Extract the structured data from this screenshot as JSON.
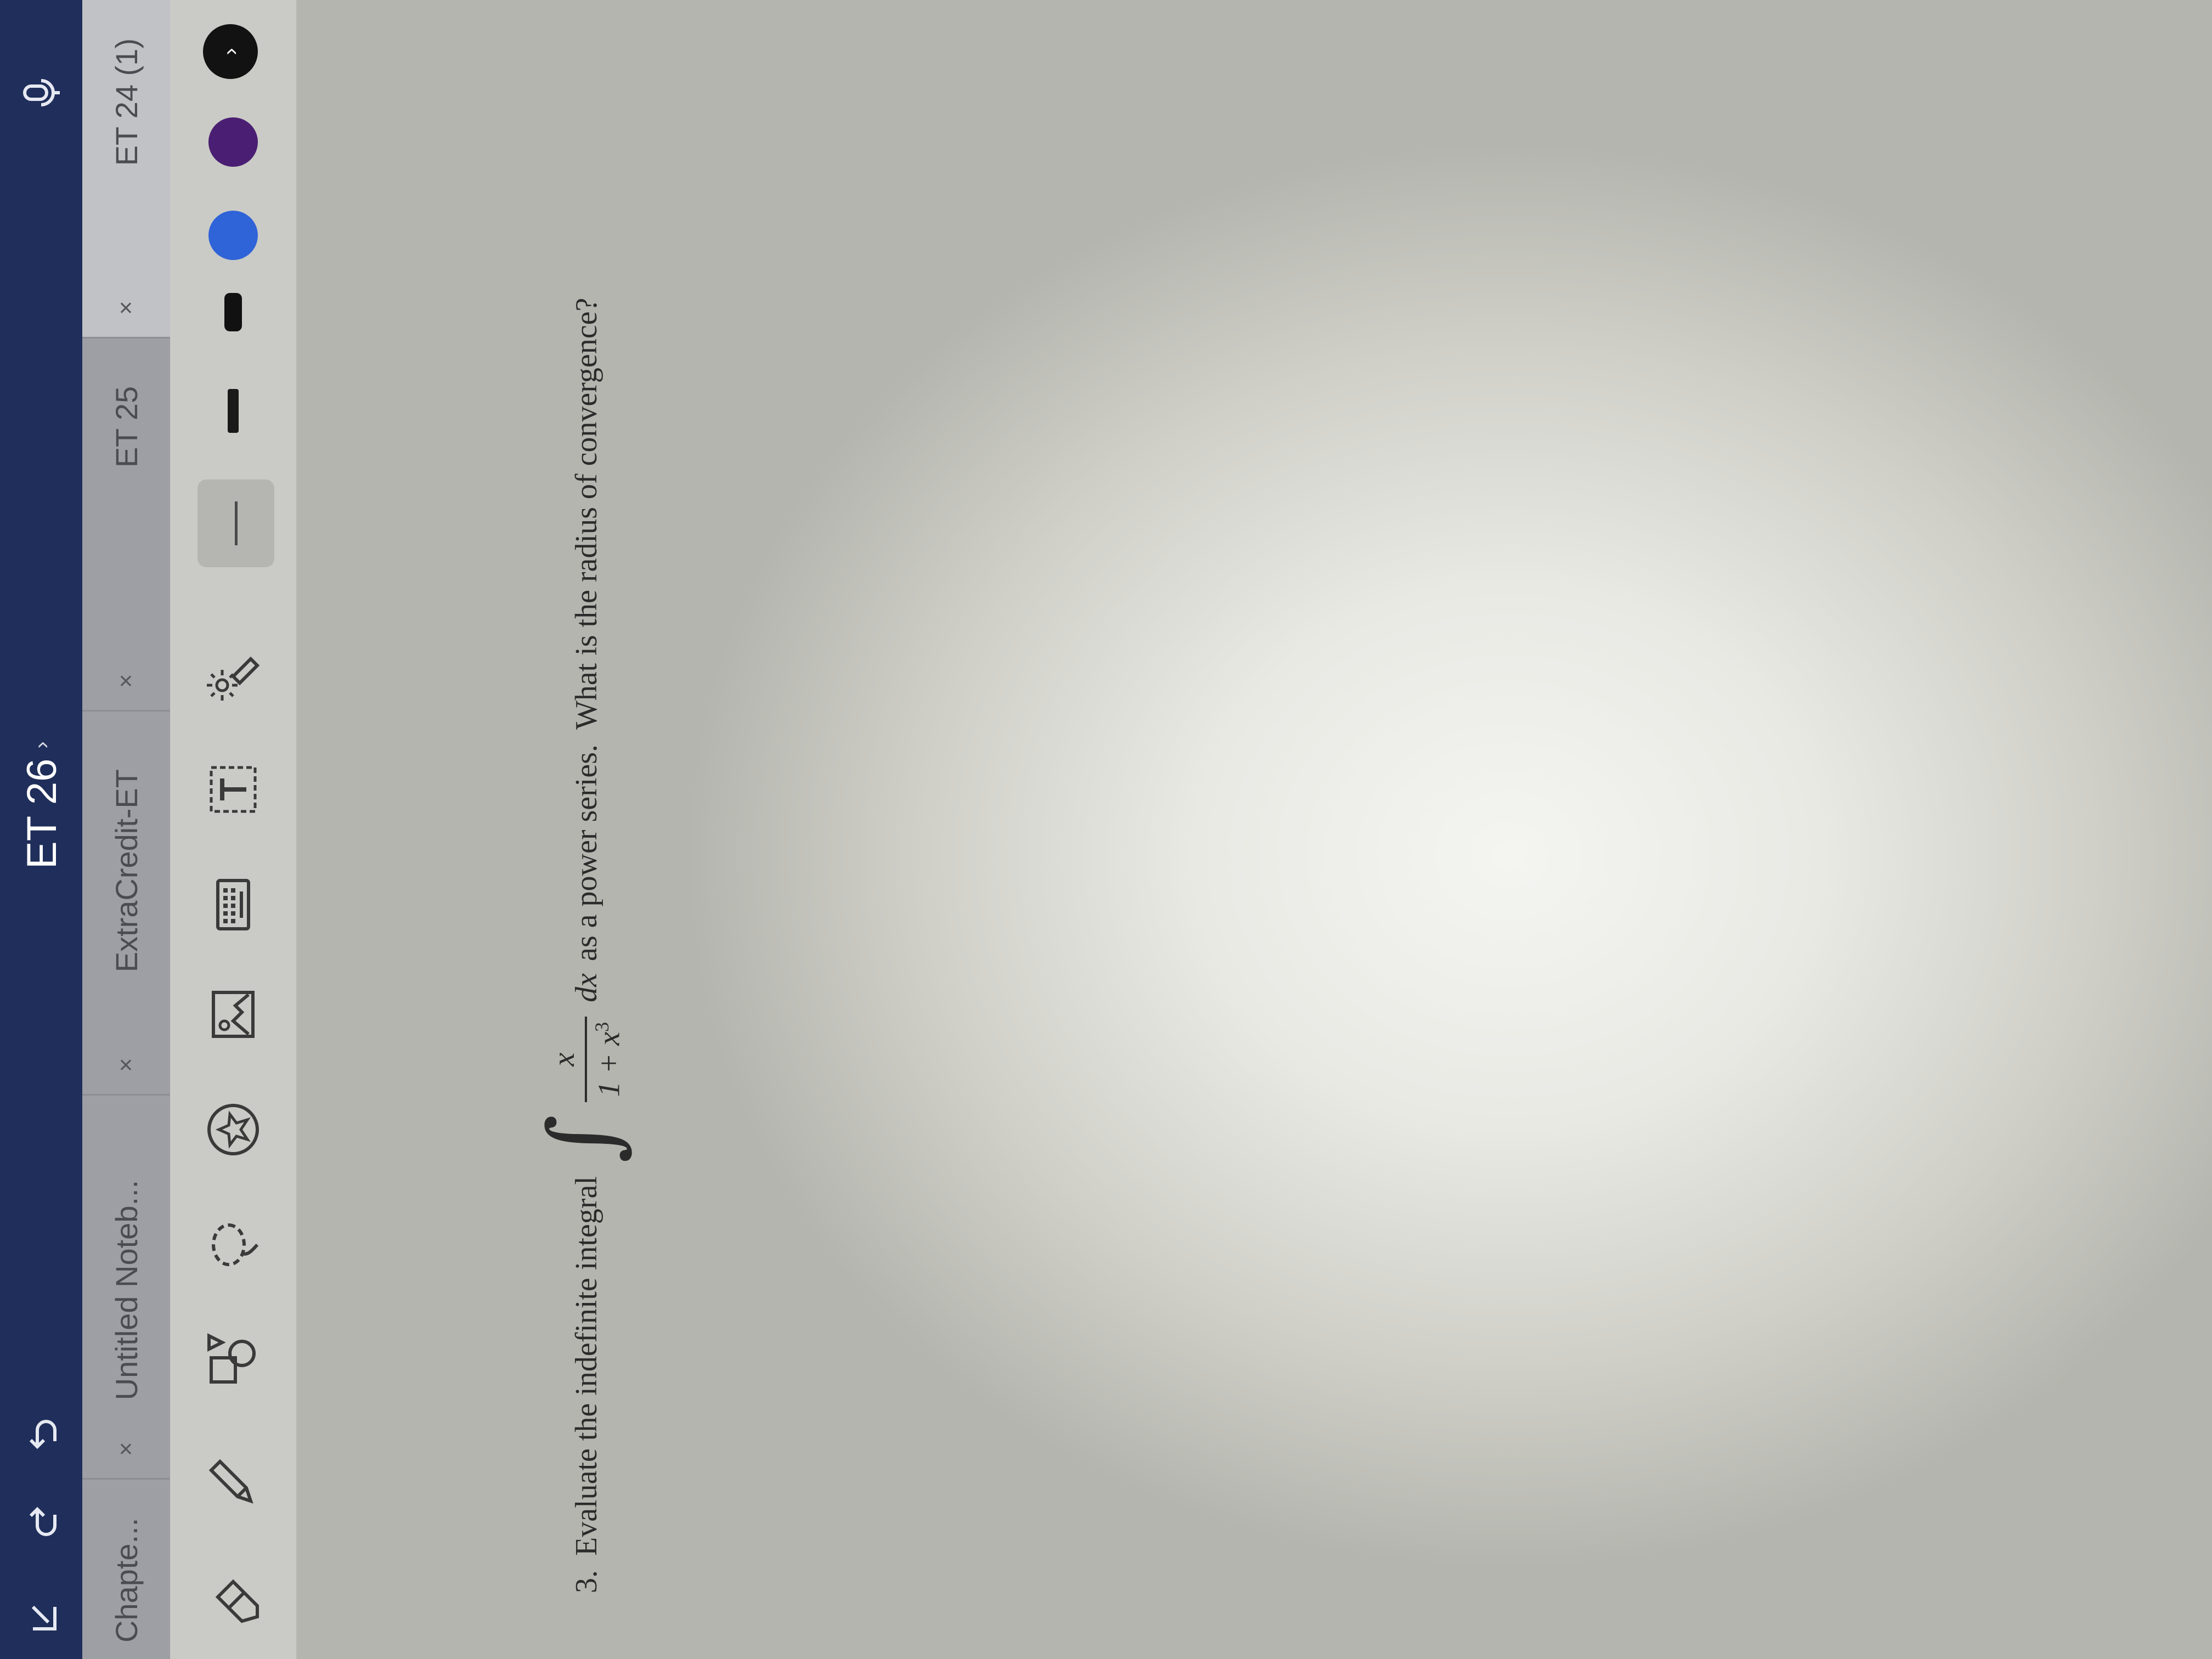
{
  "titlebar": {
    "doc_title": "ET 26",
    "doc_title_chevron": "›",
    "icons": [
      "mic-icon",
      "undo-icon",
      "redo-icon",
      "share-icon"
    ]
  },
  "tabs": [
    {
      "label": "Chapte...",
      "close": "×",
      "active": false
    },
    {
      "label": "Untitled Noteb...",
      "close": "×",
      "active": false
    },
    {
      "label": "ExtraCredit-ET",
      "close": "×",
      "active": false
    },
    {
      "label": "ET 25",
      "close": "×",
      "active": false
    },
    {
      "label": "ET 24 (1)",
      "close": "×",
      "active": true
    }
  ],
  "toolbar": {
    "tools": [
      "eraser-icon",
      "pencil-icon",
      "shapes-icon",
      "lasso-icon",
      "sticker-icon",
      "image-icon",
      "keyboard-icon",
      "text-box-icon",
      "laser-pointer-icon",
      "thin-line-icon",
      "medium-line-icon",
      "thick-line-icon"
    ],
    "colors": [
      "#2f63d8",
      "#4a1f73",
      "#121212"
    ],
    "more": "›"
  },
  "question": {
    "number": "3.",
    "prefix": "Evaluate the indefinite integral",
    "integral": "∫",
    "numerator": "x",
    "denominator_base": "1 + x",
    "denominator_exp": "3",
    "differential": "dx",
    "suffix": "as a power series.  What is the radius of convergence?"
  }
}
